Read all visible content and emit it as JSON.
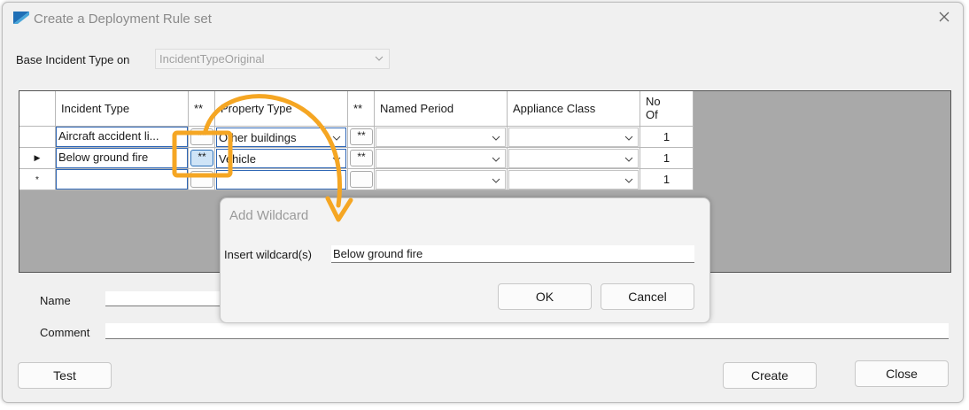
{
  "window": {
    "title": "Create a Deployment Rule set"
  },
  "base": {
    "label": "Base Incident Type on",
    "value": "IncidentTypeOriginal"
  },
  "grid": {
    "headers": {
      "incident_type": "Incident Type",
      "wild1": "**",
      "property_type": "Property Type",
      "wild2": "**",
      "named_period": "Named Period",
      "appliance_class": "Appliance Class",
      "no_of_1": "No",
      "no_of_2": "Of"
    },
    "rows": [
      {
        "indicator": "",
        "incident_type": "Aircraft accident li...",
        "wild1": "**",
        "property_type": "Other buildings",
        "wild2": "**",
        "named_period": "",
        "appliance_class": "",
        "no_of": "1"
      },
      {
        "indicator": "▶",
        "incident_type": "Below ground fire",
        "wild1": "**",
        "property_type": "Vehicle",
        "wild2": "**",
        "named_period": "",
        "appliance_class": "",
        "no_of": "1"
      },
      {
        "indicator": "*",
        "incident_type": "",
        "wild1": "",
        "property_type": "",
        "wild2": "",
        "named_period": "",
        "appliance_class": "",
        "no_of": "1"
      }
    ]
  },
  "form": {
    "name_label": "Name",
    "comment_label": "Comment"
  },
  "buttons": {
    "test": "Test",
    "create": "Create",
    "close": "Close"
  },
  "dialog": {
    "title": "Add Wildcard",
    "field_label": "Insert wildcard(s)",
    "field_value": "Below ground fire",
    "ok": "OK",
    "cancel": "Cancel"
  },
  "colors": {
    "highlight": "#f5a623",
    "selection": "#2f67b6"
  }
}
